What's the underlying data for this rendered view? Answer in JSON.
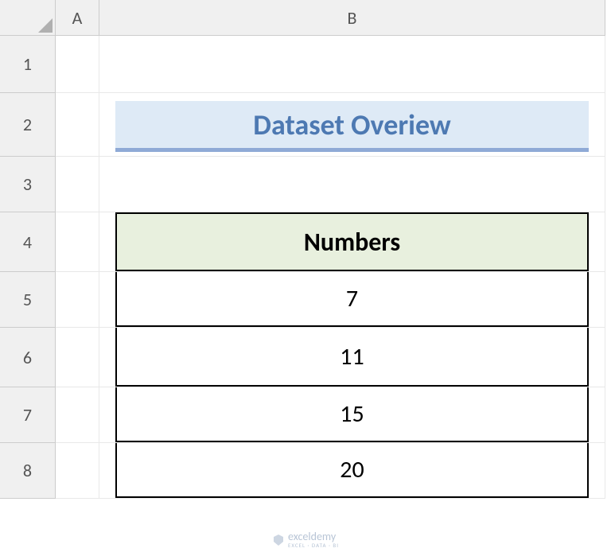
{
  "columns": {
    "A": "A",
    "B": "B"
  },
  "rows": {
    "1": "1",
    "2": "2",
    "3": "3",
    "4": "4",
    "5": "5",
    "6": "6",
    "7": "7",
    "8": "8"
  },
  "title": "Dataset Overiew",
  "table": {
    "header": "Numbers",
    "data": [
      "7",
      "11",
      "15",
      "20"
    ]
  },
  "watermark": {
    "name": "exceldemy",
    "tagline": "EXCEL · DATA · BI"
  },
  "chart_data": {
    "type": "table",
    "title": "Dataset Overiew",
    "columns": [
      "Numbers"
    ],
    "rows": [
      [
        7
      ],
      [
        11
      ],
      [
        15
      ],
      [
        20
      ]
    ]
  }
}
